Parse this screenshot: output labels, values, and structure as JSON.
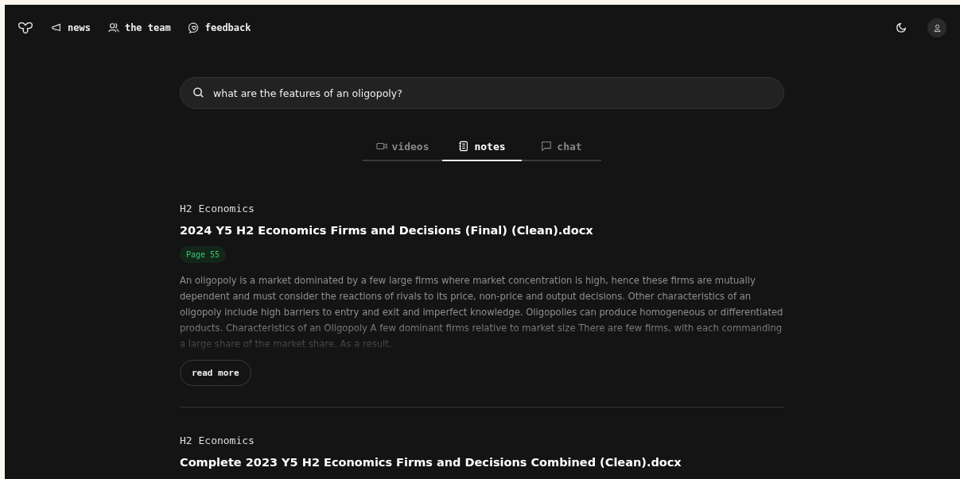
{
  "nav": {
    "links": [
      {
        "label": "news",
        "kind": "megaphone"
      },
      {
        "label": "the team",
        "kind": "people"
      },
      {
        "label": "feedback",
        "kind": "chat"
      }
    ]
  },
  "search": {
    "value": "what are the features of an oligopoly?"
  },
  "tabs": [
    {
      "label": "videos",
      "kind": "video",
      "selected": false
    },
    {
      "label": "notes",
      "kind": "note",
      "selected": true
    },
    {
      "label": "chat",
      "kind": "chat",
      "selected": false
    }
  ],
  "results": [
    {
      "category": "H2 Economics",
      "title": "2024 Y5 H2 Economics Firms and Decisions (Final) (Clean).docx",
      "page": "Page 55",
      "excerpt": "An oligopoly is a market dominated by a few large firms where market concentration is high, hence these firms are mutually dependent and must consider the reactions of rivals to its price, non-price and output decisions. Other characteristics of an oligopoly include high barriers to entry and exit and imperfect knowledge. Oligopolies can produce homogeneous or differentiated products. Characteristics of an Oligopoly A few dominant firms relative to market size There are few firms, with each commanding a large share of the market share. As a result,",
      "button": "read more"
    },
    {
      "category": "H2 Economics",
      "title": "Complete 2023 Y5 H2 Economics Firms and Decisions Combined (Clean).docx"
    }
  ]
}
